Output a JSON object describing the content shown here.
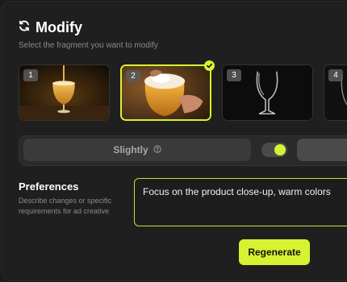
{
  "header": {
    "title": "Modify",
    "refresh_icon": "refresh-icon",
    "subtitle": "Select the fragment you want to modify"
  },
  "fragments": [
    {
      "number": "1",
      "content": "beer glass being poured",
      "selected": false
    },
    {
      "number": "2",
      "content": "hand holding foamy beer glass",
      "selected": true
    },
    {
      "number": "3",
      "content": "empty glass on black background",
      "selected": false
    },
    {
      "number": "4",
      "content": "partially visible",
      "selected": false
    }
  ],
  "controls": {
    "intensity_label": "Slightly",
    "help_icon": "help-circle-icon",
    "toggle_on": true
  },
  "preferences": {
    "title": "Preferences",
    "description": "Describe changes or specific requirements for ad creative",
    "input_value": "Focus on the product close-up, warm colors"
  },
  "actions": {
    "regenerate_label": "Regenerate"
  },
  "colors": {
    "accent": "#d6f230",
    "background": "#1f1f1f",
    "surface": "#2a2a2a"
  }
}
